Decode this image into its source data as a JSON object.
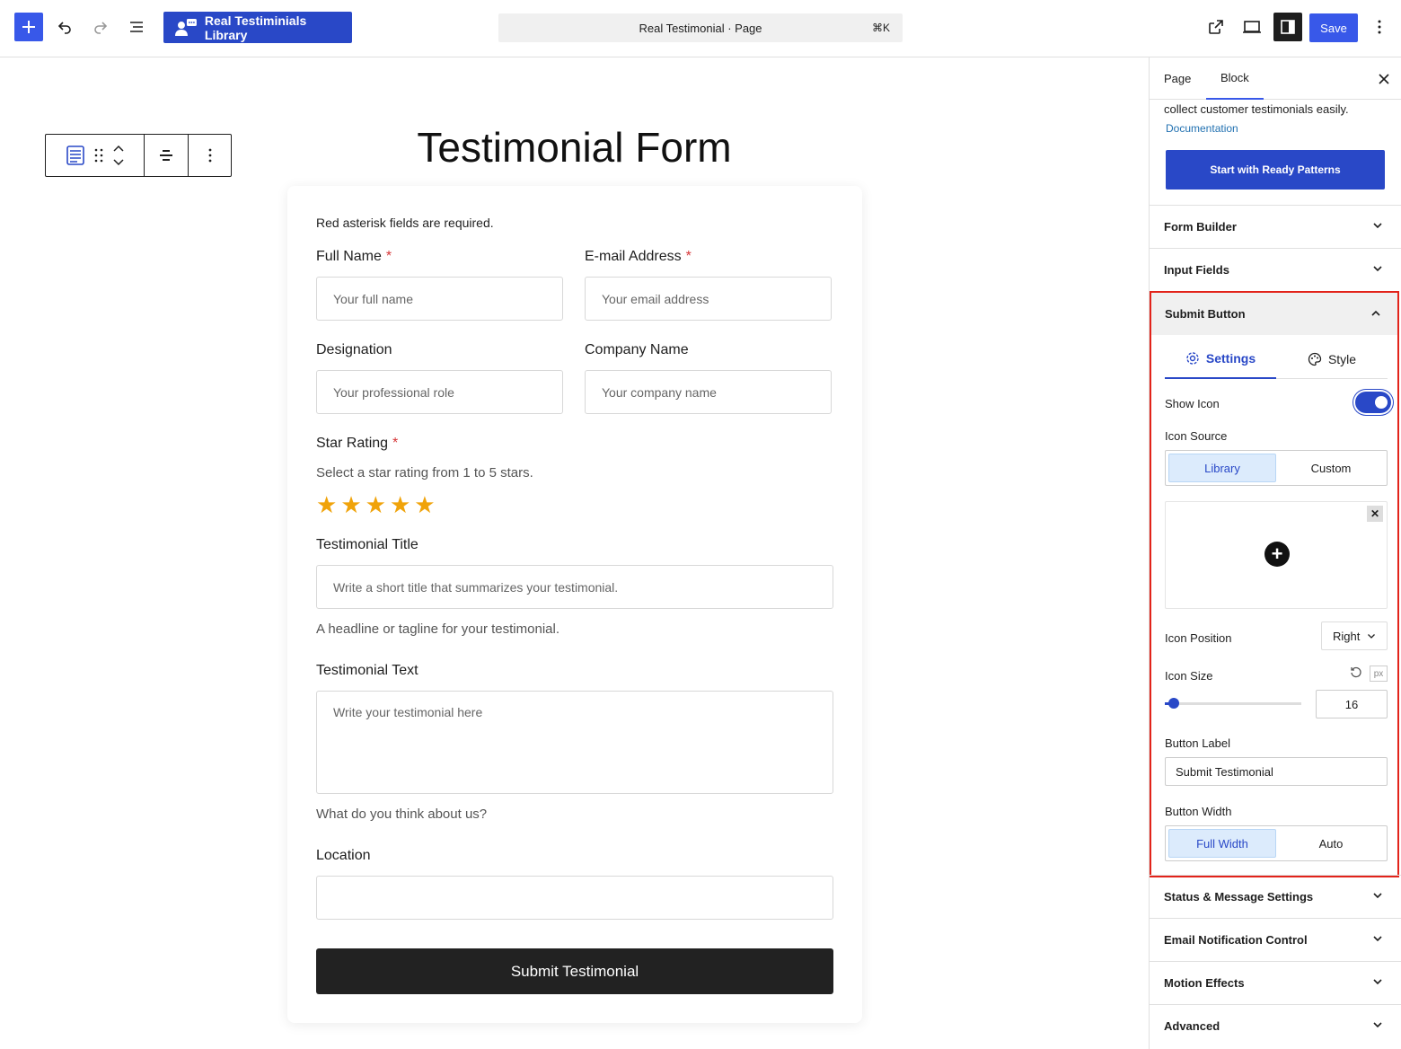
{
  "toolbar": {
    "plugin_label": "Real Testiminials Library",
    "doc_title": "Real Testimonial · Page",
    "shortcut": "⌘K",
    "save_label": "Save"
  },
  "canvas": {
    "page_title": "Testimonial Form"
  },
  "form": {
    "note": "Red asterisk fields are required.",
    "required_mark": "*",
    "full_name_label": "Full Name",
    "full_name_placeholder": "Your full name",
    "email_label": "E-mail Address",
    "email_placeholder": "Your email address",
    "designation_label": "Designation",
    "designation_placeholder": "Your professional role",
    "company_label": "Company Name",
    "company_placeholder": "Your company name",
    "rating_label": "Star Rating",
    "rating_help": "Select a star rating from 1 to 5 stars.",
    "rating_value": 5,
    "title_label": "Testimonial Title",
    "title_placeholder": "Write a short title that summarizes your testimonial.",
    "title_help": "A headline or tagline for your testimonial.",
    "text_label": "Testimonial Text",
    "text_placeholder": "Write your testimonial here",
    "text_help": "What do you think about us?",
    "location_label": "Location",
    "submit_label": "Submit Testimonial"
  },
  "sidebar": {
    "tab_page": "Page",
    "tab_block": "Block",
    "description": "collect customer testimonials easily.",
    "doc_link": "Documentation",
    "pattern_button": "Start with Ready Patterns",
    "panels": {
      "form_builder": "Form Builder",
      "input_fields": "Input Fields",
      "submit_button": "Submit Button",
      "status_message": "Status & Message Settings",
      "email_notification": "Email Notification Control",
      "motion_effects": "Motion Effects",
      "advanced": "Advanced"
    },
    "submit": {
      "tab_settings": "Settings",
      "tab_style": "Style",
      "show_icon_label": "Show Icon",
      "icon_source_label": "Icon Source",
      "source_library": "Library",
      "source_custom": "Custom",
      "icon_position_label": "Icon Position",
      "icon_position_value": "Right",
      "icon_size_label": "Icon Size",
      "icon_size_unit": "px",
      "icon_size_value": "16",
      "button_label_label": "Button Label",
      "button_label_value": "Submit Testimonial",
      "button_width_label": "Button Width",
      "width_full": "Full Width",
      "width_auto": "Auto"
    }
  },
  "colors": {
    "accent": "#3858e9",
    "brand_blue": "#2948c7",
    "highlight_border": "#e2231a",
    "star": "#f0a30a"
  }
}
